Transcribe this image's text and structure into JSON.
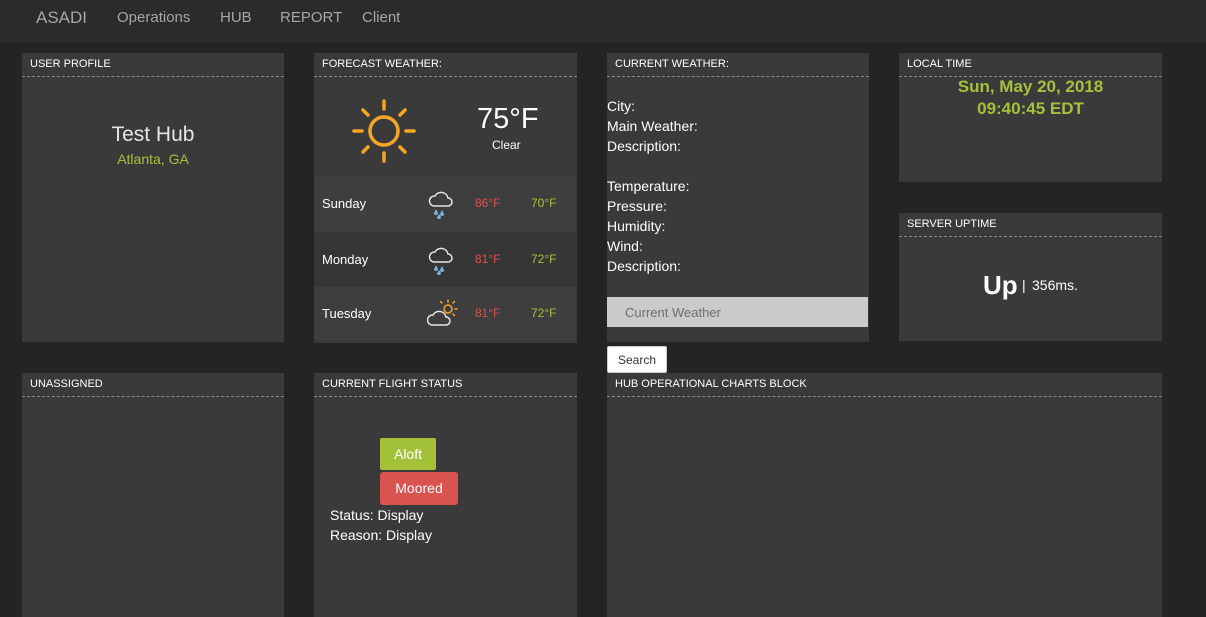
{
  "nav": {
    "brand": "ASADI",
    "links": [
      "Operations",
      "HUB",
      "REPORT",
      "Client"
    ]
  },
  "user_profile": {
    "title": "USER PROFILE",
    "name": "Test Hub",
    "location": "Atlanta, GA"
  },
  "forecast": {
    "title": "FORECAST WEATHER:",
    "current_icon": "sun-icon",
    "current_temp": "75°F",
    "current_desc": "Clear",
    "days": [
      {
        "day": "Sunday",
        "icon": "rain-cloud-icon",
        "high": "86°F",
        "low": "70°F"
      },
      {
        "day": "Monday",
        "icon": "rain-cloud-icon",
        "high": "81°F",
        "low": "72°F"
      },
      {
        "day": "Tuesday",
        "icon": "partly-cloudy-icon",
        "high": "81°F",
        "low": "72°F"
      }
    ]
  },
  "current_weather": {
    "title": "CURRENT WEATHER:",
    "labels": [
      "City:",
      "Main Weather:",
      "Description:",
      "Temperature:",
      "Pressure:",
      "Humidity:",
      "Wind:",
      "Description:"
    ],
    "input_placeholder": "Current Weather",
    "search_label": "Search"
  },
  "local_time": {
    "title": "LOCAL TIME",
    "date": "Sun, May 20, 2018",
    "time": "09:40:45 EDT"
  },
  "server_uptime": {
    "title": "SERVER UPTIME",
    "status": "Up",
    "separator": "|",
    "latency": "356ms."
  },
  "unassigned": {
    "title": "UNASSIGNED"
  },
  "flight_status": {
    "title": "CURRENT FLIGHT STATUS",
    "aloft_label": "Aloft",
    "moored_label": "Moored",
    "status_line": "Status: Display",
    "reason_line": "Reason: Display"
  },
  "charts_block": {
    "title": "HUB OPERATIONAL CHARTS BLOCK"
  },
  "colors": {
    "accent_green": "#a4c13a",
    "accent_red": "#d9534f",
    "panel_bg": "#3a3a3a",
    "page_bg": "#242424",
    "sun_orange": "#f5a623",
    "rain_blue": "#7fb0e0"
  }
}
